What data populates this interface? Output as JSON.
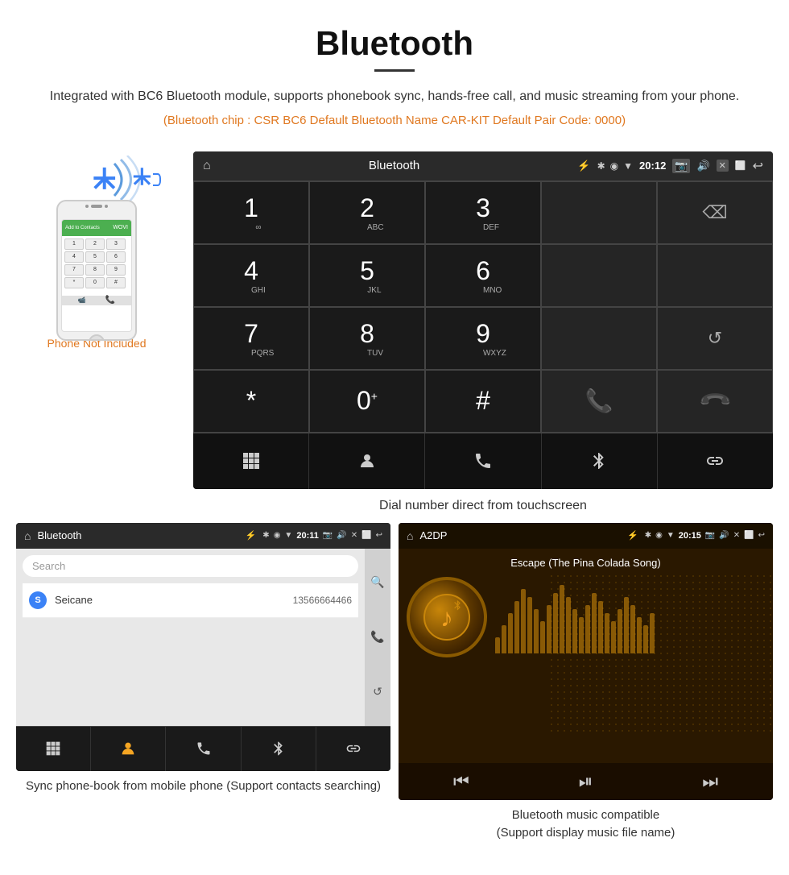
{
  "page": {
    "title": "Bluetooth",
    "title_underline": true,
    "description": "Integrated with BC6 Bluetooth module, supports phonebook sync, hands-free call, and music streaming from your phone.",
    "specs": "(Bluetooth chip : CSR BC6    Default Bluetooth Name CAR-KIT    Default Pair Code: 0000)",
    "dial_caption": "Dial number direct from touchscreen",
    "phonebook_caption": "Sync phone-book from mobile phone\n(Support contacts searching)",
    "music_caption": "Bluetooth music compatible\n(Support display music file name)"
  },
  "phone": {
    "not_included_label": "Phone Not Included",
    "add_to_contacts": "Add to Contacts"
  },
  "dial_screen": {
    "status_title": "Bluetooth",
    "time": "20:12",
    "usb_icon": "⚡",
    "keys": [
      {
        "num": "1",
        "sub": "∞"
      },
      {
        "num": "2",
        "sub": "ABC"
      },
      {
        "num": "3",
        "sub": "DEF"
      },
      {
        "num": "",
        "sub": ""
      },
      {
        "num": "⌫",
        "sub": ""
      },
      {
        "num": "4",
        "sub": "GHI"
      },
      {
        "num": "5",
        "sub": "JKL"
      },
      {
        "num": "6",
        "sub": "MNO"
      },
      {
        "num": "",
        "sub": ""
      },
      {
        "num": "",
        "sub": ""
      },
      {
        "num": "7",
        "sub": "PQRS"
      },
      {
        "num": "8",
        "sub": "TUV"
      },
      {
        "num": "9",
        "sub": "WXYZ"
      },
      {
        "num": "",
        "sub": ""
      },
      {
        "num": "↺",
        "sub": ""
      },
      {
        "num": "*",
        "sub": ""
      },
      {
        "num": "0",
        "sub": "+"
      },
      {
        "num": "#",
        "sub": ""
      },
      {
        "num": "📞",
        "sub": ""
      },
      {
        "num": "📞",
        "sub": "end"
      }
    ],
    "nav_icons": [
      "⠿",
      "👤",
      "📞",
      "✱",
      "🔗"
    ]
  },
  "phonebook_screen": {
    "status_title": "Bluetooth",
    "time": "20:11",
    "search_placeholder": "Search",
    "contact_letter": "S",
    "contact_name": "Seicane",
    "contact_number": "13566664466",
    "right_icons": [
      "🔍",
      "📞",
      "↺"
    ],
    "nav_icons": [
      "⠿",
      "👤",
      "📞",
      "✱",
      "🔗"
    ]
  },
  "music_screen": {
    "status_title": "A2DP",
    "time": "20:15",
    "song_title": "Escape (The Pina Colada Song)",
    "nav_icons": [
      "⏮",
      "⏯",
      "⏭"
    ],
    "waveform_heights": [
      20,
      35,
      50,
      65,
      80,
      70,
      55,
      40,
      60,
      75,
      85,
      70,
      55,
      45,
      60,
      75,
      65,
      50,
      40,
      55,
      70,
      60,
      45,
      35,
      50
    ]
  },
  "colors": {
    "orange": "#e07820",
    "bt_blue": "#3b82f6",
    "green_call": "#4caf50",
    "red_call": "#f44336",
    "screen_dark": "#1a1a1a",
    "music_bg": "#2a1800"
  }
}
